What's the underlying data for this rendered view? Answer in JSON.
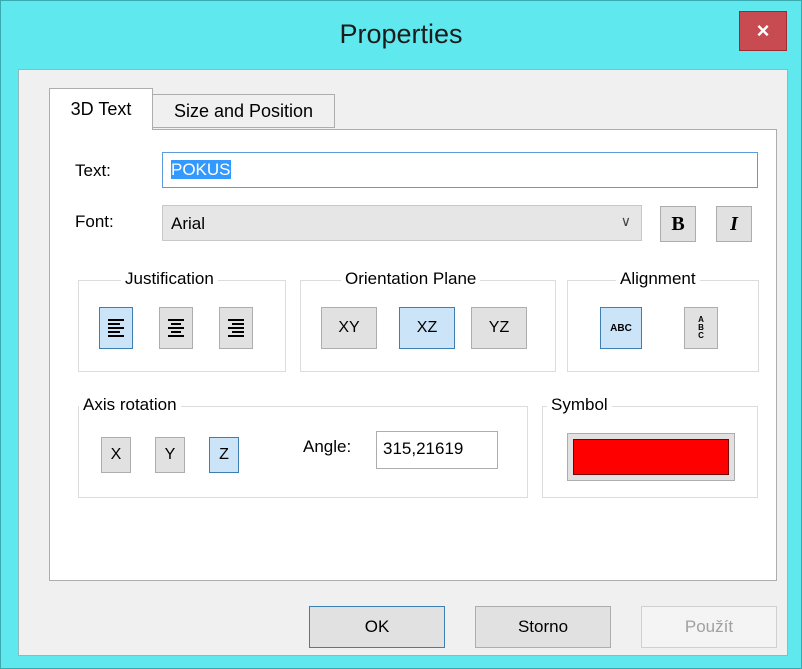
{
  "window": {
    "title": "Properties",
    "close_glyph": "×"
  },
  "tabs": [
    {
      "label": "3D Text",
      "active": true
    },
    {
      "label": "Size and Position",
      "active": false
    }
  ],
  "fields": {
    "text_label": "Text:",
    "text_value": "POKUS",
    "font_label": "Font:",
    "font_value": "Arial",
    "bold_glyph": "B",
    "italic_glyph": "I"
  },
  "justification": {
    "title": "Justification",
    "options": [
      "left",
      "center",
      "right"
    ],
    "selected": "left"
  },
  "orientation_plane": {
    "title": "Orientation Plane",
    "options": [
      "XY",
      "XZ",
      "YZ"
    ],
    "selected": "XZ"
  },
  "alignment": {
    "title": "Alignment",
    "horizontal_label": "ABC",
    "vertical_letters": [
      "A",
      "B",
      "C"
    ],
    "selected": "horizontal"
  },
  "axis_rotation": {
    "title": "Axis rotation",
    "axes": [
      "X",
      "Y",
      "Z"
    ],
    "selected": "Z",
    "angle_label": "Angle:",
    "angle_value": "315,21619"
  },
  "symbol": {
    "title": "Symbol",
    "color": "#ff0000"
  },
  "buttons": {
    "ok": "OK",
    "cancel": "Storno",
    "apply": "Použít"
  }
}
